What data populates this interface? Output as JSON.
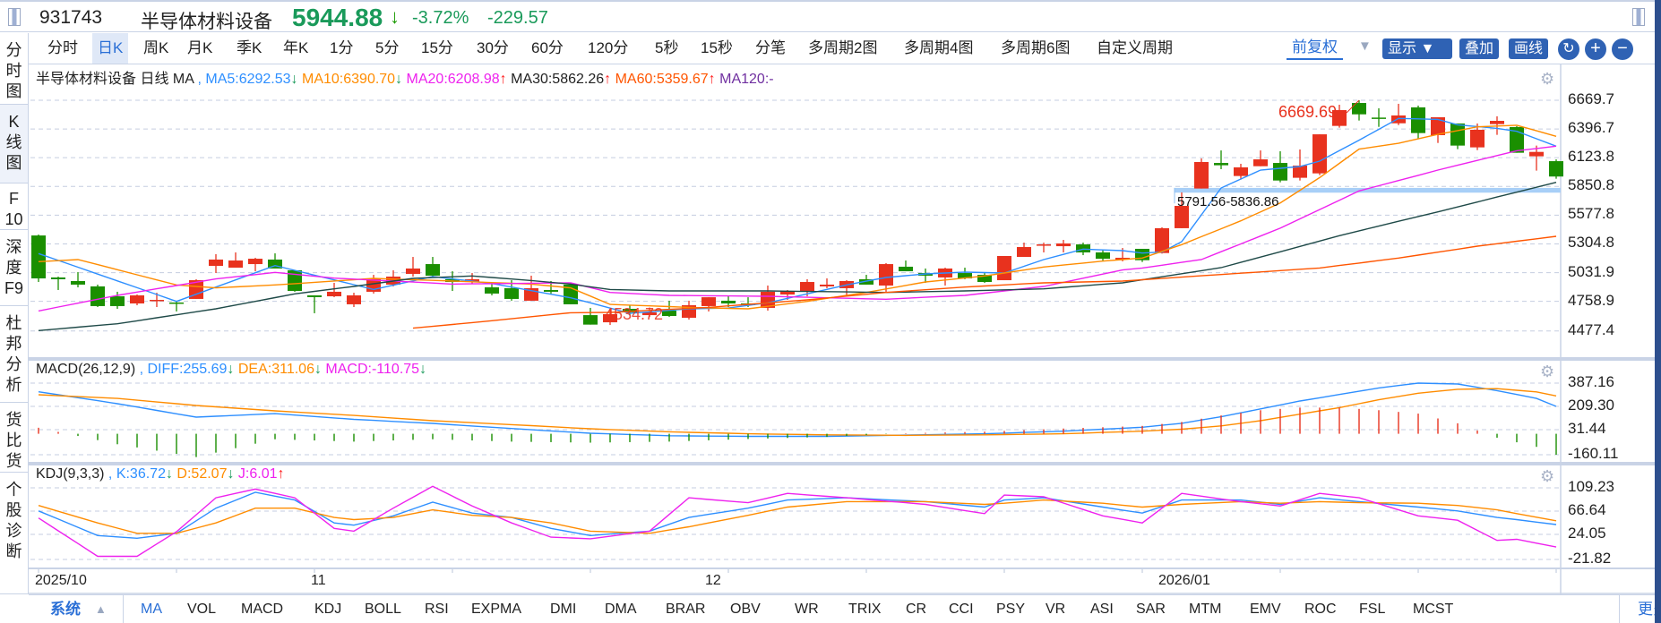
{
  "header": {
    "code": "931743",
    "name": "半导体材料设备",
    "price": "5944.88",
    "price_arrow": "↓",
    "pct": "-3.72%",
    "change": "-229.57",
    "down_color": "#1a9a5a"
  },
  "periods": [
    "分时",
    "日K",
    "周K",
    "月K",
    "季K",
    "年K",
    "1分",
    "5分",
    "15分",
    "30分",
    "60分",
    "120分",
    "5秒",
    "15秒",
    "分笔",
    "多周期2图",
    "多周期4图",
    "多周期6图",
    "自定义周期"
  ],
  "selected_period": "日K",
  "toolbar": {
    "adjust": "前复权",
    "display": "显示",
    "overlay": "叠加",
    "draw": "画线",
    "refresh_icon": "refresh-icon",
    "zoom_in": "+",
    "zoom_out": "−"
  },
  "sidebar": [
    "分时图",
    "K线图",
    "F10",
    "深度F9",
    "杜邦分析",
    "货比货",
    "个股诊断"
  ],
  "sidebar_selected": "K线图",
  "main_info": {
    "name": "半导体材料设备",
    "period": "日线",
    "indicator": "MA",
    "sep": ",",
    "items": [
      {
        "text": "MA5:6292.53",
        "arrow": "↓",
        "color": "#2e8fff"
      },
      {
        "text": "MA10:6390.70",
        "arrow": "↓",
        "color": "#ff8c00"
      },
      {
        "text": "MA20:6208.98",
        "arrow": "↑",
        "color": "#ee22ee"
      },
      {
        "text": "MA30:5862.26",
        "arrow": "↑",
        "color": "#222222"
      },
      {
        "text": "MA60:5359.67",
        "arrow": "↑",
        "color": "#ff5500"
      },
      {
        "text": "MA120:-",
        "arrow": "",
        "color": "#7030a0"
      }
    ]
  },
  "macd_info": {
    "name": "MACD(26,12,9)",
    "sep": ",",
    "items": [
      {
        "text": "DIFF:255.69",
        "arrow": "↓",
        "color": "#2e8fff"
      },
      {
        "text": "DEA:311.06",
        "arrow": "↓",
        "color": "#ff8c00"
      },
      {
        "text": "MACD:-110.75",
        "arrow": "↓",
        "color": "#ee22ee"
      }
    ]
  },
  "kdj_info": {
    "name": "KDJ(9,3,3)",
    "sep": ",",
    "items": [
      {
        "text": "K:36.72",
        "arrow": "↓",
        "color": "#2e8fff"
      },
      {
        "text": "D:52.07",
        "arrow": "↓",
        "color": "#ff8c00"
      },
      {
        "text": "J:6.01",
        "arrow": "↑",
        "color": "#ee22ee"
      }
    ]
  },
  "bottom_tabs": {
    "system": "系统",
    "items": [
      "MA",
      "VOL",
      "MACD",
      "KDJ",
      "BOLL",
      "RSI",
      "EXPMA",
      "DMI",
      "DMA",
      "BRAR",
      "OBV",
      "WR",
      "TRIX",
      "CR",
      "CCI",
      "PSY",
      "VR",
      "ASI",
      "SAR",
      "MTM",
      "EMV",
      "ROC",
      "FSL",
      "MCST"
    ],
    "selected": "MA",
    "more": "更多"
  },
  "chart_data": [
    {
      "type": "candlestick",
      "panel": "main",
      "colors": {
        "up": "#e8321e",
        "down": "#1a8f00"
      },
      "y_ticks": [
        6669.7,
        6396.7,
        6123.8,
        5850.8,
        5577.8,
        5304.8,
        5031.9,
        4758.9,
        4477.4
      ],
      "x_labels": [
        {
          "label": "2025/10",
          "bar": 0
        },
        {
          "label": "11",
          "bar": 14
        },
        {
          "label": "12",
          "bar": 34
        },
        {
          "label": "2026/01",
          "bar": 57
        }
      ],
      "ohlc": [
        [
          5385,
          5394,
          4943,
          4977
        ],
        [
          4986,
          4994,
          4867,
          4969
        ],
        [
          4952,
          5037,
          4892,
          4918
        ],
        [
          4901,
          4918,
          4705,
          4714
        ],
        [
          4807,
          4850,
          4688,
          4714
        ],
        [
          4739,
          4824,
          4722,
          4816
        ],
        [
          4765,
          4841,
          4705,
          4773
        ],
        [
          4748,
          4765,
          4663,
          4739
        ],
        [
          4782,
          4969,
          4782,
          4960
        ],
        [
          5096,
          5207,
          5028,
          5156
        ],
        [
          5079,
          5224,
          5079,
          5147
        ],
        [
          5113,
          5173,
          5045,
          5164
        ],
        [
          5156,
          5215,
          5071,
          5071
        ],
        [
          5054,
          5054,
          4850,
          4858
        ],
        [
          4816,
          4816,
          4646,
          4799
        ],
        [
          4807,
          4935,
          4799,
          4850
        ],
        [
          4731,
          4841,
          4705,
          4816
        ],
        [
          4850,
          5011,
          4833,
          4977
        ],
        [
          4918,
          5054,
          4901,
          4994
        ],
        [
          5020,
          5181,
          4994,
          5071
        ],
        [
          5113,
          5181,
          4986,
          5003
        ],
        [
          4969,
          5045,
          4858,
          4943
        ],
        [
          4943,
          5028,
          4926,
          4969
        ],
        [
          4892,
          4926,
          4816,
          4833
        ],
        [
          4884,
          4960,
          4765,
          4782
        ],
        [
          4765,
          5003,
          4765,
          4884
        ],
        [
          4867,
          4952,
          4833,
          4850
        ],
        [
          4918,
          4935,
          4731,
          4731
        ],
        [
          4628,
          4697,
          4538,
          4538
        ],
        [
          4560,
          4688,
          4535,
          4637
        ],
        [
          4688,
          4722,
          4628,
          4654
        ],
        [
          4628,
          4700,
          4610,
          4654
        ],
        [
          4671,
          4765,
          4611,
          4620
        ],
        [
          4603,
          4765,
          4586,
          4722
        ],
        [
          4714,
          4798,
          4663,
          4798
        ],
        [
          4765,
          4807,
          4705,
          4739
        ],
        [
          4739,
          4798,
          4705,
          4722
        ],
        [
          4697,
          4909,
          4671,
          4850
        ],
        [
          4824,
          4867,
          4773,
          4858
        ],
        [
          4850,
          4969,
          4807,
          4943
        ],
        [
          4901,
          4977,
          4884,
          4918
        ],
        [
          4884,
          4960,
          4816,
          4952
        ],
        [
          4969,
          5011,
          4918,
          4918
        ],
        [
          4909,
          5122,
          4850,
          5113
        ],
        [
          5088,
          5147,
          5045,
          5045
        ],
        [
          5028,
          5071,
          4935,
          5003
        ],
        [
          4986,
          5079,
          4909,
          5071
        ],
        [
          5028,
          5079,
          4969,
          4977
        ],
        [
          5011,
          5028,
          4935,
          4943
        ],
        [
          4960,
          5190,
          4960,
          5190
        ],
        [
          5181,
          5317,
          5181,
          5275
        ],
        [
          5292,
          5317,
          5224,
          5300
        ],
        [
          5283,
          5343,
          5224,
          5309
        ],
        [
          5300,
          5317,
          5198,
          5224
        ],
        [
          5224,
          5249,
          5147,
          5164
        ],
        [
          5156,
          5266,
          5139,
          5173
        ],
        [
          5258,
          5258,
          5133,
          5150
        ],
        [
          5218,
          5462,
          5213,
          5454
        ],
        [
          5454,
          5794,
          5454,
          5666
        ],
        [
          5831,
          6117,
          5831,
          6083
        ],
        [
          6074,
          6193,
          6015,
          6052
        ],
        [
          5950,
          6066,
          5916,
          6032
        ],
        [
          6043,
          6193,
          6043,
          6108
        ],
        [
          6074,
          6185,
          5890,
          5907
        ],
        [
          5933,
          6202,
          5907,
          6049
        ],
        [
          5975,
          6346,
          5958,
          6346
        ],
        [
          6426,
          6627,
          6409,
          6576
        ],
        [
          6644,
          6670,
          6477,
          6536
        ],
        [
          6505,
          6593,
          6417,
          6497
        ],
        [
          6451,
          6636,
          6434,
          6525
        ],
        [
          6602,
          6619,
          6307,
          6358
        ],
        [
          6338,
          6508,
          6264,
          6508
        ],
        [
          6449,
          6449,
          6205,
          6239
        ],
        [
          6222,
          6449,
          6196,
          6389
        ],
        [
          6443,
          6517,
          6341,
          6474
        ],
        [
          6415,
          6423,
          6171,
          6171
        ],
        [
          6137,
          6239,
          6001,
          6179
        ],
        [
          6091,
          6108,
          5924,
          5945
        ]
      ],
      "lines": [
        {
          "name": "MA5",
          "color": "#2e8fff",
          "by_bar": {
            "0": 5213,
            "7": 4759,
            "12": 5099,
            "17": 4872,
            "20": 4994,
            "23": 4929,
            "27": 4793,
            "28": 4745,
            "30": 4645,
            "33": 4688,
            "35": 4696,
            "37": 4745,
            "39": 4830,
            "41": 4915,
            "43": 4986,
            "45": 5020,
            "47": 5037,
            "49": 5028,
            "51": 5156,
            "53": 5255,
            "55": 5241,
            "56": 5218,
            "57": 5227,
            "58": 5326,
            "60": 5836,
            "62": 6006,
            "64": 6040,
            "65": 6091,
            "67": 6290,
            "69": 6497,
            "71": 6488,
            "72": 6437,
            "74": 6403,
            "75": 6375,
            "77": 6233
          }
        },
        {
          "name": "MA10",
          "color": "#ff8c00",
          "by_bar": {
            "0": 5136,
            "2": 5156,
            "7": 4915,
            "9": 4887,
            "12": 4915,
            "17": 4977,
            "21": 4952,
            "25": 4923,
            "27": 4887,
            "29": 4730,
            "33": 4702,
            "36": 4688,
            "39": 4759,
            "42": 4844,
            "45": 4943,
            "48": 5000,
            "51": 5085,
            "54": 5141,
            "56": 5170,
            "58": 5298,
            "61": 5524,
            "63": 5694,
            "65": 5935,
            "67": 6205,
            "69": 6261,
            "71": 6346,
            "73": 6417,
            "75": 6432,
            "77": 6327
          }
        },
        {
          "name": "MA20",
          "color": "#ee22ee",
          "by_bar": {
            "0": 4668,
            "4": 4816,
            "9": 4972,
            "12": 5034,
            "15": 4980,
            "18": 4952,
            "21": 4923,
            "27": 4935,
            "29": 4844,
            "32": 4816,
            "37": 4807,
            "43": 4779,
            "47": 4816,
            "51": 4901,
            "55": 5057,
            "56": 5076,
            "59": 5156,
            "63": 5454,
            "67": 5808,
            "71": 6006,
            "75": 6190,
            "77": 6233
          }
        },
        {
          "name": "MA30",
          "color": "#1f4a48",
          "by_bar": {
            "0": 4481,
            "4": 4546,
            "9": 4688,
            "13": 4830,
            "16": 4901,
            "19": 4977,
            "22": 5000,
            "25": 4957,
            "27": 4923,
            "29": 4872,
            "32": 4858,
            "37": 4858,
            "43": 4844,
            "47": 4858,
            "51": 4878,
            "55": 4935,
            "60": 5079,
            "63": 5230,
            "66": 5383,
            "69": 5520,
            "71": 5609,
            "74": 5750,
            "77": 5890
          }
        },
        {
          "name": "MA60",
          "color": "#ff5500",
          "by_bar": {
            "19": 4504,
            "23": 4575,
            "27": 4651,
            "29": 4654,
            "34": 4702,
            "39": 4773,
            "43": 4844,
            "47": 4895,
            "51": 4935,
            "55": 4952,
            "65": 5076,
            "69": 5170,
            "73": 5283,
            "77": 5377
          }
        }
      ],
      "annotations": {
        "high": {
          "text": "6669.69",
          "bar": 67,
          "value": 6669.69,
          "color": "#e8321e"
        },
        "low": {
          "text": "4534.72",
          "bar": 29,
          "value": 4534.72,
          "color": "#e8321e"
        },
        "range": {
          "text": "5791.56-5836.86",
          "from_bar": 58,
          "low": 5791.56,
          "high": 5836.86,
          "color": "#a8cff7"
        }
      }
    },
    {
      "type": "macd",
      "panel": "macd",
      "y_ticks": [
        387.16,
        209.3,
        31.44,
        -160.11
      ],
      "colors": {
        "up": "#e8321e",
        "down": "#1a8f00"
      },
      "lines": [
        {
          "name": "DIFF",
          "color": "#2e8fff",
          "by_bar": {
            "0": 321,
            "4": 230,
            "8": 127,
            "12": 154,
            "16": 110,
            "20": 79,
            "24": 40,
            "28": 4,
            "32": -15,
            "36": -20,
            "40": -20,
            "44": -10,
            "48": 0,
            "52": 20,
            "56": 50,
            "58": 80,
            "60": 130,
            "62": 190,
            "64": 250,
            "66": 300,
            "68": 350,
            "70": 387,
            "72": 380,
            "74": 330,
            "76": 270,
            "77": 209
          }
        },
        {
          "name": "DEA",
          "color": "#ff8c00",
          "by_bar": {
            "0": 298,
            "4": 270,
            "8": 216,
            "12": 175,
            "16": 140,
            "20": 100,
            "24": 70,
            "28": 38,
            "32": 15,
            "36": 0,
            "40": -8,
            "44": -12,
            "48": -8,
            "52": 0,
            "56": 20,
            "58": 35,
            "60": 60,
            "62": 100,
            "64": 150,
            "66": 200,
            "68": 260,
            "70": 310,
            "72": 340,
            "74": 345,
            "76": 320,
            "77": 289
          }
        }
      ]
    },
    {
      "type": "line",
      "panel": "kdj",
      "y_ticks": [
        109.23,
        66.64,
        24.05,
        -21.82
      ],
      "lines": [
        {
          "name": "K",
          "color": "#2e8fff",
          "by_bar": {
            "0": 67,
            "3": 22,
            "5": 17,
            "7": 26,
            "9": 72,
            "11": 101,
            "13": 87,
            "15": 45,
            "16": 41,
            "18": 58,
            "20": 83,
            "22": 63,
            "24": 55,
            "26": 35,
            "28": 22,
            "31": 30,
            "33": 55,
            "36": 72,
            "38": 87,
            "41": 91,
            "45": 84,
            "48": 74,
            "49": 87,
            "51": 91,
            "54": 74,
            "56": 63,
            "58": 87,
            "61": 87,
            "63": 79,
            "65": 91,
            "67": 84,
            "70": 74,
            "72": 67,
            "74": 55,
            "75": 51,
            "77": 42
          }
        },
        {
          "name": "D",
          "color": "#ff8c00",
          "by_bar": {
            "0": 77,
            "3": 45,
            "5": 26,
            "7": 26,
            "9": 45,
            "11": 72,
            "13": 72,
            "15": 55,
            "16": 51,
            "18": 55,
            "20": 69,
            "22": 59,
            "24": 55,
            "26": 45,
            "28": 30,
            "31": 26,
            "33": 38,
            "36": 59,
            "38": 74,
            "41": 84,
            "45": 84,
            "48": 79,
            "49": 81,
            "51": 87,
            "54": 81,
            "56": 74,
            "58": 79,
            "61": 84,
            "63": 81,
            "65": 84,
            "67": 82,
            "70": 81,
            "72": 77,
            "74": 69,
            "75": 62,
            "77": 49
          }
        },
        {
          "name": "J",
          "color": "#ee22ee",
          "by_bar": {
            "0": 54,
            "3": -16,
            "5": -16,
            "7": 29,
            "9": 91,
            "11": 107,
            "13": 91,
            "15": 35,
            "16": 30,
            "18": 72,
            "20": 112,
            "22": 76,
            "24": 45,
            "26": 19,
            "28": 16,
            "31": 30,
            "33": 91,
            "36": 82,
            "38": 99,
            "41": 91,
            "45": 79,
            "48": 62,
            "49": 96,
            "51": 93,
            "54": 58,
            "56": 45,
            "58": 99,
            "61": 84,
            "63": 76,
            "65": 99,
            "67": 91,
            "70": 58,
            "72": 50,
            "74": 13,
            "75": 15,
            "77": 1
          }
        }
      ]
    }
  ]
}
